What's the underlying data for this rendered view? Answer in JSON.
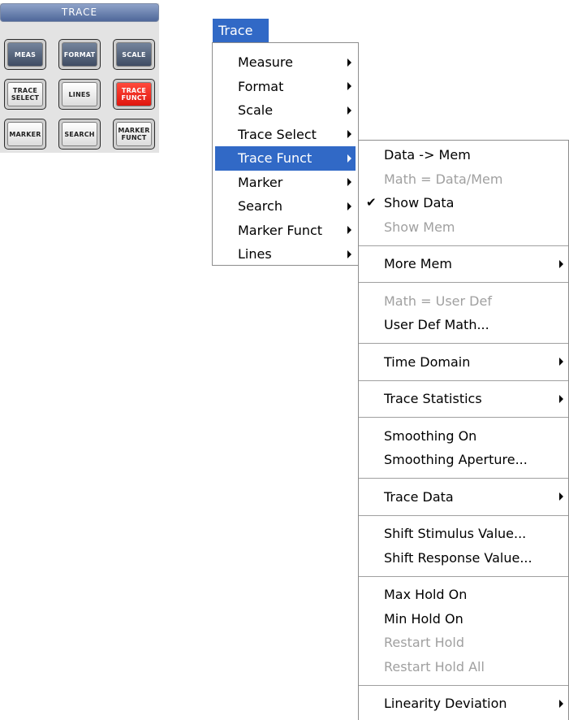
{
  "panel": {
    "title": "TRACE",
    "keys": [
      {
        "label": "MEAS",
        "style": "dark"
      },
      {
        "label": "FORMAT",
        "style": "dark"
      },
      {
        "label": "SCALE",
        "style": "dark"
      },
      {
        "label": "TRACE\nSELECT",
        "style": "light"
      },
      {
        "label": "LINES",
        "style": "light"
      },
      {
        "label": "TRACE\nFUNCT",
        "style": "red"
      },
      {
        "label": "MARKER",
        "style": "light"
      },
      {
        "label": "SEARCH",
        "style": "light"
      },
      {
        "label": "MARKER\nFUNCT",
        "style": "light"
      }
    ]
  },
  "menubar": {
    "title": "Trace"
  },
  "main_menu": {
    "items": [
      {
        "label": "Measure",
        "submenu": true
      },
      {
        "label": "Format",
        "submenu": true
      },
      {
        "label": "Scale",
        "submenu": true
      },
      {
        "label": "Trace Select",
        "submenu": true
      },
      {
        "label": "Trace Funct",
        "submenu": true,
        "active": true
      },
      {
        "label": "Marker",
        "submenu": true
      },
      {
        "label": "Search",
        "submenu": true
      },
      {
        "label": "Marker Funct",
        "submenu": true
      },
      {
        "label": "Lines",
        "submenu": true
      }
    ]
  },
  "sub_menu": {
    "items": [
      {
        "label": "Data -> Mem"
      },
      {
        "label": "Math = Data/Mem",
        "disabled": true
      },
      {
        "label": "Show Data",
        "checked": true
      },
      {
        "label": "Show Mem",
        "disabled": true
      },
      {
        "separator": true
      },
      {
        "label": "More Mem",
        "submenu": true
      },
      {
        "separator": true
      },
      {
        "label": "Math = User Def",
        "disabled": true
      },
      {
        "label": "User Def Math..."
      },
      {
        "separator": true
      },
      {
        "label": "Time Domain",
        "submenu": true
      },
      {
        "separator": true
      },
      {
        "label": "Trace Statistics",
        "submenu": true
      },
      {
        "separator": true
      },
      {
        "label": "Smoothing On"
      },
      {
        "label": "Smoothing Aperture..."
      },
      {
        "separator": true
      },
      {
        "label": "Trace Data",
        "submenu": true
      },
      {
        "separator": true
      },
      {
        "label": "Shift Stimulus Value..."
      },
      {
        "label": "Shift Response Value..."
      },
      {
        "separator": true
      },
      {
        "label": "Max Hold On"
      },
      {
        "label": "Min Hold On"
      },
      {
        "label": "Restart Hold",
        "disabled": true
      },
      {
        "label": "Restart Hold All",
        "disabled": true
      },
      {
        "separator": true
      },
      {
        "label": "Linearity Deviation",
        "submenu": true
      }
    ]
  },
  "colors": {
    "highlight": "#3169c6",
    "disabled_text": "#a0a0a0",
    "active_key": "#e0160e"
  },
  "icons": {
    "submenu": "submenu-arrow-icon",
    "check": "checkmark-icon"
  }
}
